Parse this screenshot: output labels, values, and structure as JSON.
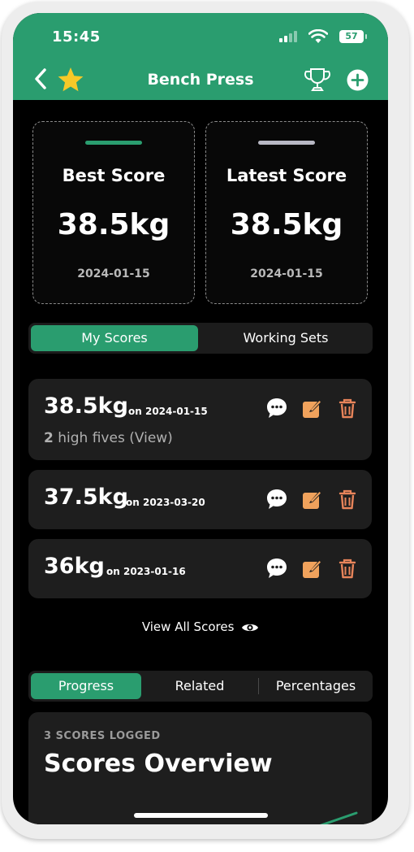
{
  "status_bar": {
    "time": "15:45",
    "battery": "57"
  },
  "header": {
    "title": "Bench Press"
  },
  "cards": {
    "best": {
      "label": "Best Score",
      "value": "38.5kg",
      "date": "2024-01-15",
      "accent": "#2a9d6f"
    },
    "latest": {
      "label": "Latest Score",
      "value": "38.5kg",
      "date": "2024-01-15",
      "accent": "#b8b8c4"
    }
  },
  "score_tabs": {
    "active": "My Scores",
    "items": [
      "My Scores",
      "Working Sets"
    ]
  },
  "entries": [
    {
      "value": "38.5kg",
      "date": "on 2024-01-15",
      "high_fives_count": "2",
      "high_fives_text": "high fives (View)"
    },
    {
      "value": "37.5kg",
      "date": "on 2023-03-20"
    },
    {
      "value": "36kg",
      "date": "on 2023-01-16"
    }
  ],
  "view_all": {
    "label": "View All Scores"
  },
  "chart_tabs": {
    "active": "Progress",
    "items": [
      "Progress",
      "Related",
      "Percentages"
    ]
  },
  "overview": {
    "count": "3 SCORES LOGGED",
    "heading": "Scores Overview"
  },
  "colors": {
    "brand": "#2a9d6f",
    "edit": "#f0a25c",
    "delete": "#e8845a"
  },
  "icons": [
    "chevron-left-icon",
    "star-icon",
    "trophy-icon",
    "plus-circle-icon",
    "comment-icon",
    "edit-icon",
    "trash-icon",
    "eye-icon"
  ]
}
